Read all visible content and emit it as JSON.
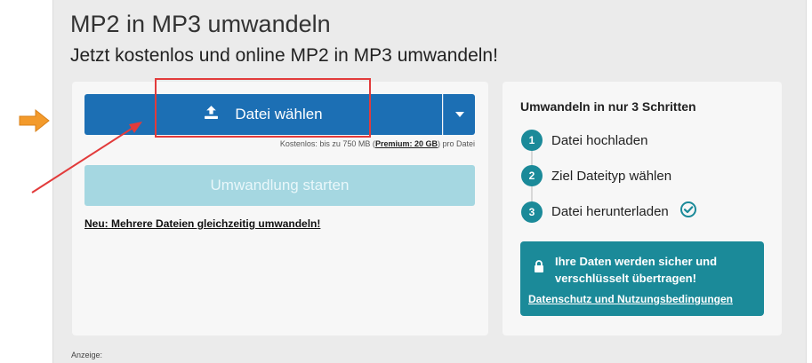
{
  "header": {
    "title": "MP2 in MP3 umwandeln",
    "subtitle": "Jetzt kostenlos und online MP2 in MP3 umwandeln!"
  },
  "upload": {
    "choose_label": "Datei wählen",
    "choose_icon": "upload-icon",
    "dropdown_icon": "chevron-down-icon",
    "size_note_prefix": "Kostenlos: bis zu 750 MB (",
    "size_note_premium": "Premium: 20 GB",
    "size_note_suffix": ") pro Datei",
    "start_label": "Umwandlung starten",
    "multi_link": "Neu: Mehrere Dateien gleichzeitig umwandeln!"
  },
  "steps": {
    "title": "Umwandeln in nur 3 Schritten",
    "items": [
      {
        "num": "1",
        "label": "Datei hochladen"
      },
      {
        "num": "2",
        "label": "Ziel Dateityp wählen"
      },
      {
        "num": "3",
        "label": "Datei herunterladen"
      }
    ],
    "done_icon": "check-circle-icon"
  },
  "security": {
    "icon": "lock-icon",
    "text": "Ihre Daten werden sicher und verschlüsselt übertragen!",
    "link": "Datenschutz und Nutzungsbedingungen"
  },
  "ad": {
    "label": "Anzeige:"
  },
  "colors": {
    "primary_blue": "#1c6fb4",
    "teal": "#1b8a99",
    "disabled_teal": "#a5d7e1",
    "annotation_red": "#e23b3b",
    "annotation_orange": "#f39a2b"
  }
}
